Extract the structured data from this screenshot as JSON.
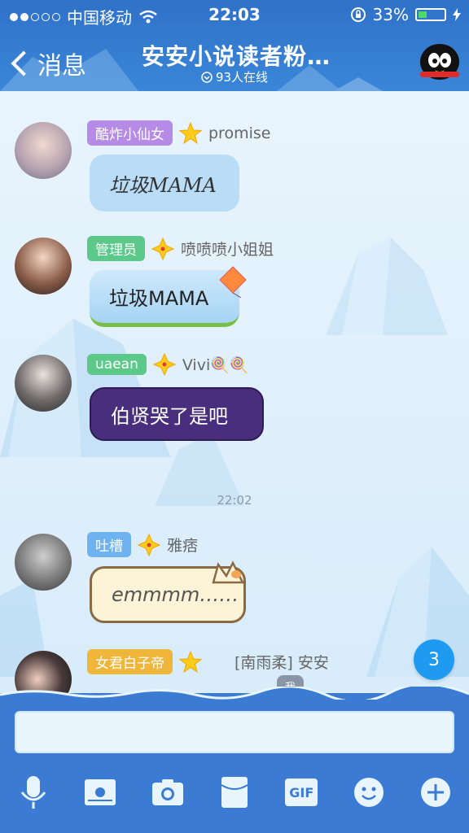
{
  "status_bar": {
    "carrier": "中国移动",
    "time": "22:03",
    "battery_percent_label": "33%",
    "battery_level": 0.33
  },
  "nav": {
    "back_label": "消息",
    "title": "安安小说读者粉…",
    "online": "93人在线"
  },
  "messages": [
    {
      "tag": "酷炸小仙女",
      "tag_color": "#b58be6",
      "name": "promise",
      "text": "垃圾MAMA",
      "bubble_style": "handwritten"
    },
    {
      "tag": "管理员",
      "tag_color": "#5cc98a",
      "name": "喷喷喷小姐姐",
      "text": "垃圾MAMA",
      "bubble_style": "kite"
    },
    {
      "tag": "uaean",
      "tag_color": "#5cc98a",
      "name": "Vivi🍭🍭",
      "text": "伯贤哭了是吧",
      "bubble_style": "purple"
    },
    {
      "tag": "吐槽",
      "tag_color": "#6fb2f0",
      "name": "雅痞",
      "text": "emmmm……",
      "bubble_style": "cat"
    },
    {
      "tag": "女君白子帝",
      "tag_color": "#f0b63a",
      "name": "[南雨柔] 安安",
      "text": "",
      "bubble_style": "plain"
    }
  ],
  "timestamp": "22:02",
  "unread_count": "3",
  "me_label": "我",
  "toolbar": {
    "icons": [
      "microphone-icon",
      "photo-icon",
      "camera-icon",
      "red-packet-icon",
      "gif-icon",
      "emoji-icon",
      "plus-icon"
    ],
    "gif_label": "GIF"
  },
  "colors": {
    "header_blue": "#2f72c9",
    "bottom_blue": "#3b7bd4",
    "unread_badge": "#1e9bf0",
    "purple_bubble": "#4a2e7e"
  }
}
